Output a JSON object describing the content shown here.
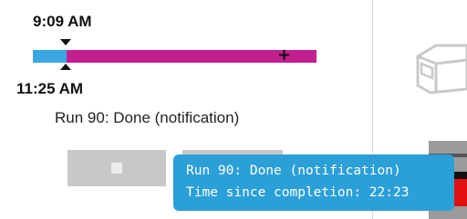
{
  "timeline": {
    "start_time": "9:09 AM",
    "end_time": "11:25 AM",
    "progress_fraction": 0.12,
    "colors": {
      "elapsed": "#3aa7e2",
      "remaining": "#c21f91"
    },
    "plus_icon": "plus-icon"
  },
  "run": {
    "status_label": "Run 90: Done (notification)"
  },
  "tooltip": {
    "line1": "Run 90: Done (notification)",
    "line2": "Time since completion: 22:23",
    "background": "#2b9fd8"
  },
  "icons": {
    "stop": "stop-icon",
    "instrument": "instrument-icon"
  }
}
